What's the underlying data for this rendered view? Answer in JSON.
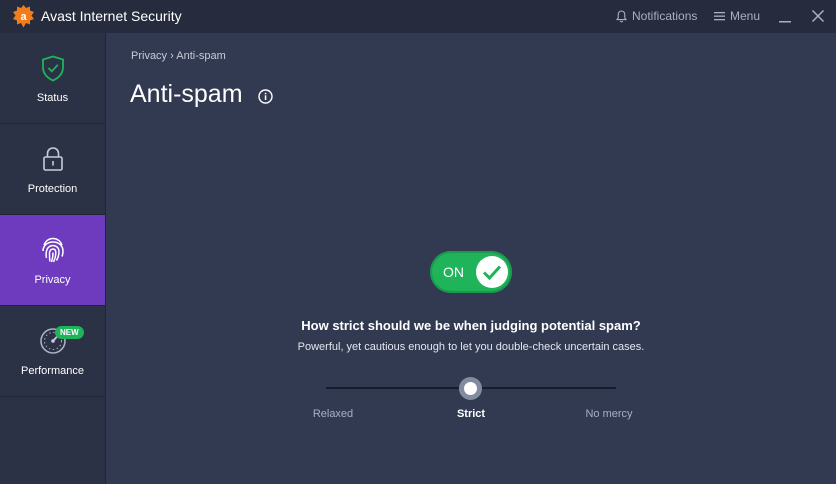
{
  "app": {
    "title": "Avast Internet Security",
    "brand_color": "#f07c1a"
  },
  "titlebar": {
    "notifications_label": "Notifications",
    "menu_label": "Menu"
  },
  "sidebar": {
    "active_color": "#6e3bbf",
    "items": [
      {
        "label": "Status",
        "icon": "shield-check-icon"
      },
      {
        "label": "Protection",
        "icon": "lock-icon"
      },
      {
        "label": "Privacy",
        "icon": "fingerprint-icon",
        "active": true
      },
      {
        "label": "Performance",
        "icon": "speedometer-icon",
        "badge": "NEW"
      }
    ]
  },
  "main": {
    "breadcrumb": {
      "parent": "Privacy",
      "separator": "›",
      "current": "Anti-spam"
    },
    "title": "Anti-spam",
    "toggle": {
      "label": "ON",
      "state": true,
      "color": "#1fb35a"
    },
    "question": "How strict should we be when judging potential spam?",
    "description": "Powerful, yet cautious enough to let you double-check uncertain cases.",
    "slider": {
      "options": [
        "Relaxed",
        "Strict",
        "No mercy"
      ],
      "selected": "Strict"
    }
  }
}
